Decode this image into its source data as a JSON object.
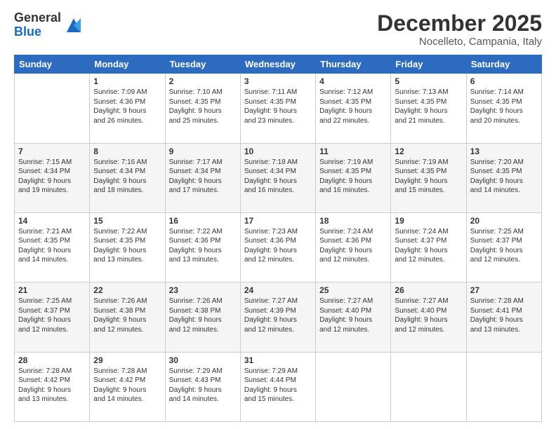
{
  "header": {
    "logo_general": "General",
    "logo_blue": "Blue",
    "month_title": "December 2025",
    "location": "Nocelleto, Campania, Italy"
  },
  "days_of_week": [
    "Sunday",
    "Monday",
    "Tuesday",
    "Wednesday",
    "Thursday",
    "Friday",
    "Saturday"
  ],
  "weeks": [
    [
      {
        "day": "",
        "info": ""
      },
      {
        "day": "1",
        "info": "Sunrise: 7:09 AM\nSunset: 4:36 PM\nDaylight: 9 hours\nand 26 minutes."
      },
      {
        "day": "2",
        "info": "Sunrise: 7:10 AM\nSunset: 4:35 PM\nDaylight: 9 hours\nand 25 minutes."
      },
      {
        "day": "3",
        "info": "Sunrise: 7:11 AM\nSunset: 4:35 PM\nDaylight: 9 hours\nand 23 minutes."
      },
      {
        "day": "4",
        "info": "Sunrise: 7:12 AM\nSunset: 4:35 PM\nDaylight: 9 hours\nand 22 minutes."
      },
      {
        "day": "5",
        "info": "Sunrise: 7:13 AM\nSunset: 4:35 PM\nDaylight: 9 hours\nand 21 minutes."
      },
      {
        "day": "6",
        "info": "Sunrise: 7:14 AM\nSunset: 4:35 PM\nDaylight: 9 hours\nand 20 minutes."
      }
    ],
    [
      {
        "day": "7",
        "info": "Sunrise: 7:15 AM\nSunset: 4:34 PM\nDaylight: 9 hours\nand 19 minutes."
      },
      {
        "day": "8",
        "info": "Sunrise: 7:16 AM\nSunset: 4:34 PM\nDaylight: 9 hours\nand 18 minutes."
      },
      {
        "day": "9",
        "info": "Sunrise: 7:17 AM\nSunset: 4:34 PM\nDaylight: 9 hours\nand 17 minutes."
      },
      {
        "day": "10",
        "info": "Sunrise: 7:18 AM\nSunset: 4:34 PM\nDaylight: 9 hours\nand 16 minutes."
      },
      {
        "day": "11",
        "info": "Sunrise: 7:19 AM\nSunset: 4:35 PM\nDaylight: 9 hours\nand 16 minutes."
      },
      {
        "day": "12",
        "info": "Sunrise: 7:19 AM\nSunset: 4:35 PM\nDaylight: 9 hours\nand 15 minutes."
      },
      {
        "day": "13",
        "info": "Sunrise: 7:20 AM\nSunset: 4:35 PM\nDaylight: 9 hours\nand 14 minutes."
      }
    ],
    [
      {
        "day": "14",
        "info": "Sunrise: 7:21 AM\nSunset: 4:35 PM\nDaylight: 9 hours\nand 14 minutes."
      },
      {
        "day": "15",
        "info": "Sunrise: 7:22 AM\nSunset: 4:35 PM\nDaylight: 9 hours\nand 13 minutes."
      },
      {
        "day": "16",
        "info": "Sunrise: 7:22 AM\nSunset: 4:36 PM\nDaylight: 9 hours\nand 13 minutes."
      },
      {
        "day": "17",
        "info": "Sunrise: 7:23 AM\nSunset: 4:36 PM\nDaylight: 9 hours\nand 12 minutes."
      },
      {
        "day": "18",
        "info": "Sunrise: 7:24 AM\nSunset: 4:36 PM\nDaylight: 9 hours\nand 12 minutes."
      },
      {
        "day": "19",
        "info": "Sunrise: 7:24 AM\nSunset: 4:37 PM\nDaylight: 9 hours\nand 12 minutes."
      },
      {
        "day": "20",
        "info": "Sunrise: 7:25 AM\nSunset: 4:37 PM\nDaylight: 9 hours\nand 12 minutes."
      }
    ],
    [
      {
        "day": "21",
        "info": "Sunrise: 7:25 AM\nSunset: 4:37 PM\nDaylight: 9 hours\nand 12 minutes."
      },
      {
        "day": "22",
        "info": "Sunrise: 7:26 AM\nSunset: 4:38 PM\nDaylight: 9 hours\nand 12 minutes."
      },
      {
        "day": "23",
        "info": "Sunrise: 7:26 AM\nSunset: 4:38 PM\nDaylight: 9 hours\nand 12 minutes."
      },
      {
        "day": "24",
        "info": "Sunrise: 7:27 AM\nSunset: 4:39 PM\nDaylight: 9 hours\nand 12 minutes."
      },
      {
        "day": "25",
        "info": "Sunrise: 7:27 AM\nSunset: 4:40 PM\nDaylight: 9 hours\nand 12 minutes."
      },
      {
        "day": "26",
        "info": "Sunrise: 7:27 AM\nSunset: 4:40 PM\nDaylight: 9 hours\nand 12 minutes."
      },
      {
        "day": "27",
        "info": "Sunrise: 7:28 AM\nSunset: 4:41 PM\nDaylight: 9 hours\nand 13 minutes."
      }
    ],
    [
      {
        "day": "28",
        "info": "Sunrise: 7:28 AM\nSunset: 4:42 PM\nDaylight: 9 hours\nand 13 minutes."
      },
      {
        "day": "29",
        "info": "Sunrise: 7:28 AM\nSunset: 4:42 PM\nDaylight: 9 hours\nand 14 minutes."
      },
      {
        "day": "30",
        "info": "Sunrise: 7:29 AM\nSunset: 4:43 PM\nDaylight: 9 hours\nand 14 minutes."
      },
      {
        "day": "31",
        "info": "Sunrise: 7:29 AM\nSunset: 4:44 PM\nDaylight: 9 hours\nand 15 minutes."
      },
      {
        "day": "",
        "info": ""
      },
      {
        "day": "",
        "info": ""
      },
      {
        "day": "",
        "info": ""
      }
    ]
  ]
}
